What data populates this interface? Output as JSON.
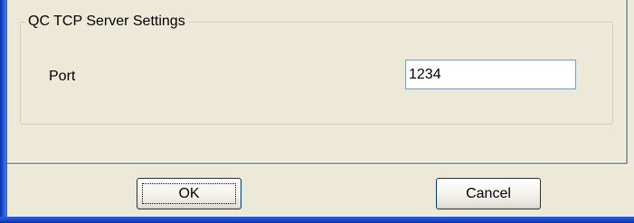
{
  "group": {
    "title": "QC TCP Server Settings"
  },
  "port": {
    "label": "Port",
    "value": "1234"
  },
  "buttons": {
    "ok_label": "OK",
    "cancel_label": "Cancel"
  },
  "colors": {
    "window_frame": "#1c4fd6",
    "dialog_background": "#ece9d8",
    "button_border": "#003c74",
    "input_border": "#7f9db9"
  }
}
